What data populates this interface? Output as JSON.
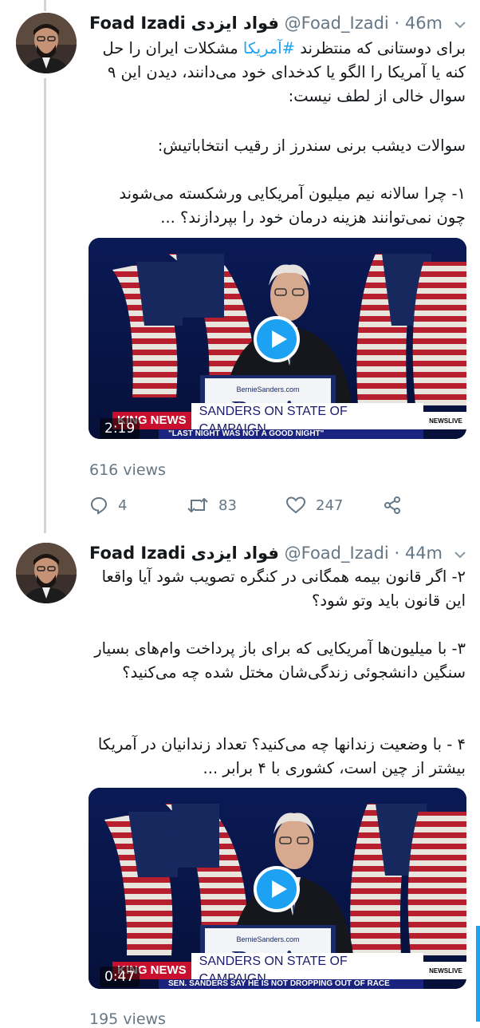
{
  "tweets": [
    {
      "display_name": "Foad Izadi",
      "display_name_fa": "فواد ایزدی",
      "handle": "@Foad_Izadi",
      "separator": "·",
      "time": "46m",
      "text_before_hashtag": "برای دوستانی که منتظرند ",
      "hashtag": "#آمریکا",
      "text_after_hashtag": " مشکلات ایران را حل کنه یا آمریکا را الگو یا کدخدای خود می‌دانند، دیدن این ۹ سوال خالی از لطف نیست:",
      "paragraph_2": "سوالات دیشب برنی سندرز از رقیب انتخاباتیش:",
      "paragraph_3": "۱- چرا سالانه نیم میلیون آمریکایی ورشکسته می‌شوند چون نمی‌توانند هزینه درمان خود را بپردازند؟ ...",
      "video": {
        "duration": "2:19",
        "ticker_breaking": "KING NEWS",
        "ticker_headline": "SANDERS ON STATE OF CAMPAIGN",
        "ticker_subline": "\"LAST NIGHT WAS NOT A GOOD NIGHT\"",
        "network": "NEWSLIVE",
        "podium_site": "BernieSanders.com",
        "podium_sign": "Bernie"
      },
      "views": "616 views",
      "replies": "4",
      "retweets": "83",
      "likes": "247"
    },
    {
      "display_name": "Foad Izadi",
      "display_name_fa": "فواد ایزدی",
      "handle": "@Foad_Izadi",
      "separator": "·",
      "time": "44m",
      "paragraph_1": "۲- اگر قانون بیمه همگانی در کنگره تصویب شود آیا واقعا این قانون باید وتو شود؟",
      "paragraph_2": "۳- با میلیون‌ها آمریکایی که برای باز پرداخت وام‌های بسیار سنگین دانشجوئی زندگی‌شان مختل شده چه می‌کنید؟",
      "paragraph_3": "۴ - با وضعیت زندانها چه می‌کنید؟ تعداد زندانیان در آمریکا بیشتر از چین است، کشوری با ۴ برابر ...",
      "video": {
        "duration": "0:47",
        "ticker_breaking": "KING NEWS",
        "ticker_headline": "SANDERS ON STATE OF CAMPAIGN",
        "ticker_subline": "SEN. SANDERS SAY HE IS NOT DROPPING OUT OF RACE",
        "network": "NEWSLIVE",
        "podium_site": "BernieSanders.com",
        "podium_sign": "Bernie"
      },
      "views": "195 views"
    }
  ],
  "colors": {
    "link": "#1da1f2",
    "secondary_text": "#657786",
    "thread_line": "#ccd6dd",
    "breaking_red": "#c8102e",
    "subline_blue": "#1a237e"
  },
  "icons": [
    "reply-icon",
    "retweet-icon",
    "like-icon",
    "share-icon",
    "chevron-down-icon",
    "play-icon"
  ]
}
